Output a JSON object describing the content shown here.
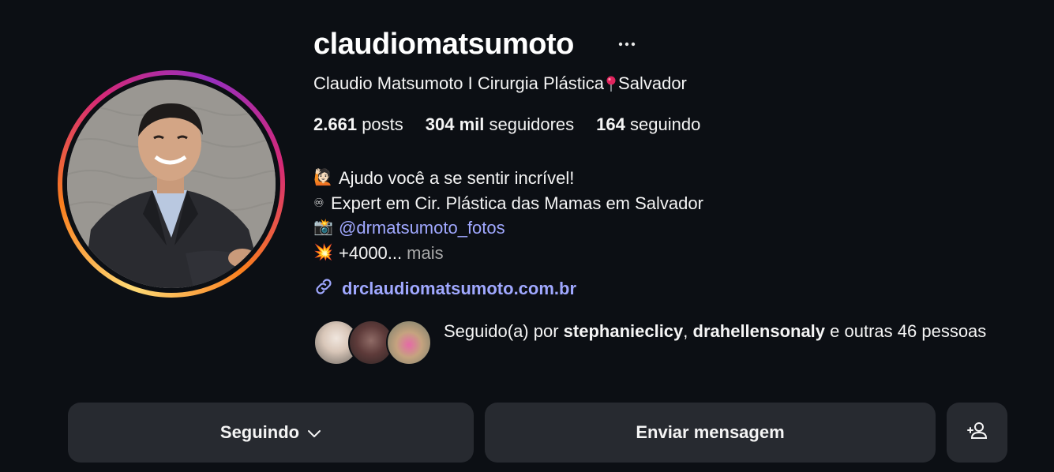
{
  "profile": {
    "username": "claudiomatsumoto",
    "more_icon": "ellipsis-icon",
    "full_name_part1": "Claudio Matsumoto I Cirurgia Plástica",
    "full_name_part2": "Salvador",
    "location_icon": "round-pushpin-icon"
  },
  "stats": {
    "posts_count": "2.661",
    "posts_label": "posts",
    "followers_count": "304 mil",
    "followers_label": "seguidores",
    "following_count": "164",
    "following_label": "seguindo"
  },
  "bio": {
    "line1_icon": "🙋🏻",
    "line1_text": "Ajudo você a se sentir incrível!",
    "line2_icon": "♾",
    "line2_text": "Expert em Cir. Plástica das Mamas em Salvador",
    "line3_icon": "📸",
    "line3_mention": "@drmatsumoto_fotos",
    "line4_icon": "💥",
    "line4_text": "+4000...",
    "more_label": "mais"
  },
  "website": {
    "icon": "link-icon",
    "url": "drclaudiomatsumoto.com.br"
  },
  "followed_by": {
    "prefix": "Seguido(a) por ",
    "user1": "stephanieclicy",
    "separator": ", ",
    "user2": "drahellensonaly",
    "suffix": " e outras 46 pessoas"
  },
  "buttons": {
    "following_label": "Seguindo",
    "following_icon": "chevron-down-icon",
    "message_label": "Enviar mensagem",
    "add_user_icon": "add-person-icon"
  },
  "colors": {
    "background": "#0c0f14",
    "button_bg": "#272a30",
    "link": "#a0a8ff",
    "muted": "#a8a8a8"
  }
}
